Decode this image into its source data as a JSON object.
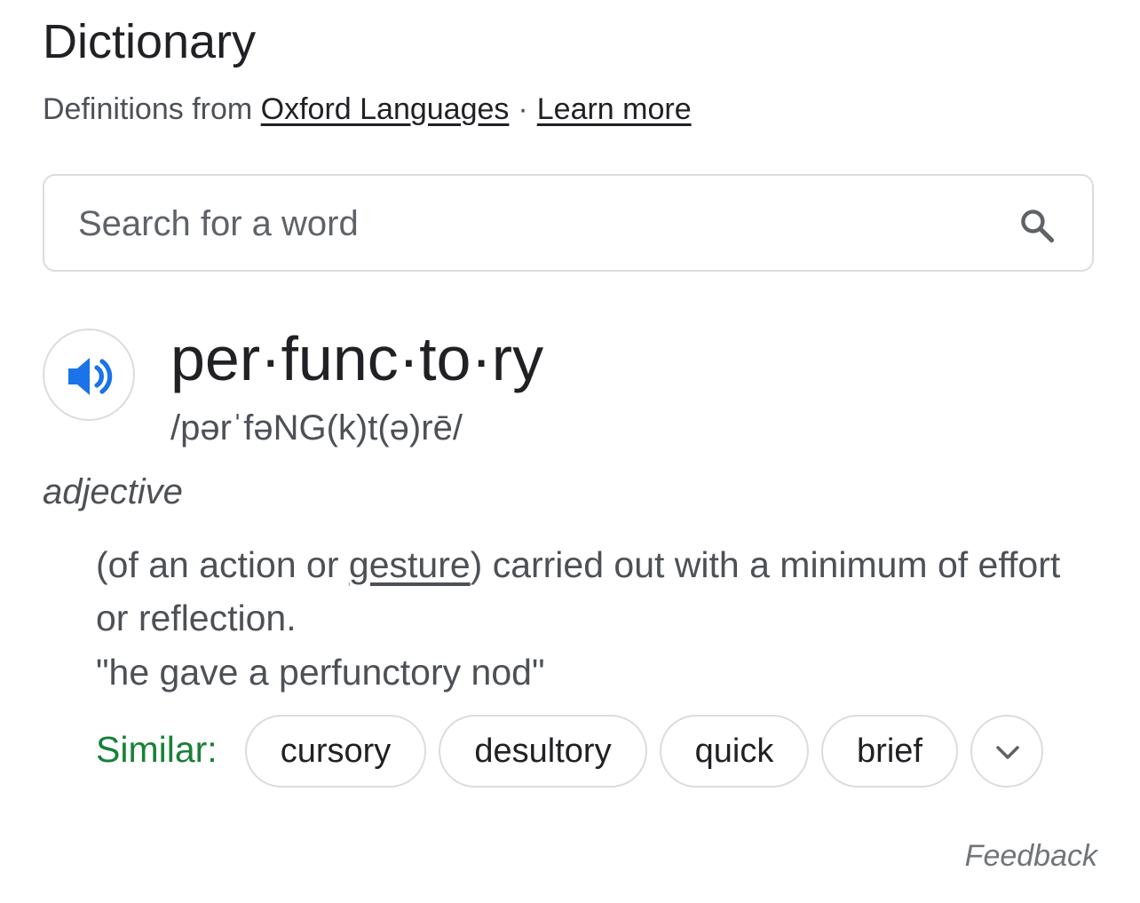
{
  "header": {
    "title": "Dictionary",
    "source_prefix": "Definitions from",
    "source_link": "Oxford Languages",
    "separator": "·",
    "learn_more": "Learn more"
  },
  "search": {
    "placeholder": "Search for a word",
    "value": "",
    "icon": "search-icon"
  },
  "entry": {
    "audio_icon": "speaker-icon",
    "headword": "per·func·to·ry",
    "phonetic": "/pərˈfəNG(k)t(ə)rē/",
    "part_of_speech": "adjective",
    "definition_before": "(of an action or ",
    "definition_link": "gesture",
    "definition_after": ") carried out with a minimum of effort or reflection.",
    "example": "\"he gave a perfunctory nod\"",
    "similar_label": "Similar:",
    "similar": [
      "cursory",
      "desultory",
      "quick",
      "brief"
    ],
    "expand_icon": "chevron-down-icon"
  },
  "footer": {
    "feedback": "Feedback"
  },
  "colors": {
    "accent_blue": "#1a73e8",
    "similar_green": "#188038",
    "border": "#dadce0",
    "text_primary": "#202124",
    "text_secondary": "#4d5156"
  }
}
